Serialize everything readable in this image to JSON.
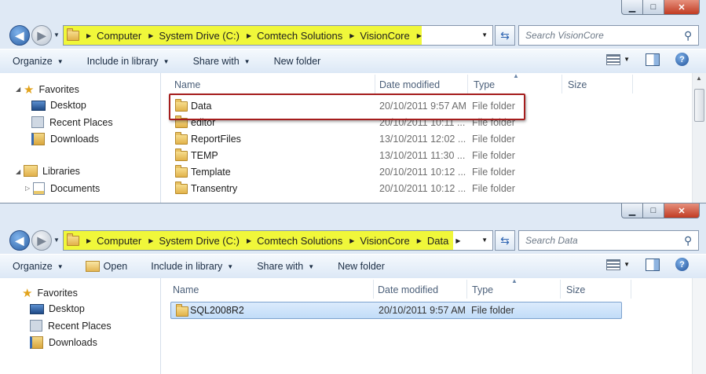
{
  "window1": {
    "breadcrumbs": [
      "Computer",
      "System Drive (C:)",
      "Comtech Solutions",
      "VisionCore"
    ],
    "search_placeholder": "Search VisionCore",
    "toolbar": {
      "organize": "Organize",
      "include": "Include in library",
      "share": "Share with",
      "new_folder": "New folder"
    },
    "nav": {
      "favorites": "Favorites",
      "desktop": "Desktop",
      "recent": "Recent Places",
      "downloads": "Downloads",
      "libraries": "Libraries",
      "documents": "Documents"
    },
    "columns": {
      "name": "Name",
      "date": "Date modified",
      "type": "Type",
      "size": "Size"
    },
    "files": [
      {
        "name": "Data",
        "date": "20/10/2011 9:57 AM",
        "type": "File folder"
      },
      {
        "name": "editor",
        "date": "20/10/2011 10:11 ...",
        "type": "File folder"
      },
      {
        "name": "ReportFiles",
        "date": "13/10/2011 12:02 ...",
        "type": "File folder"
      },
      {
        "name": "TEMP",
        "date": "13/10/2011 11:30 ...",
        "type": "File folder"
      },
      {
        "name": "Template",
        "date": "20/10/2011 10:12 ...",
        "type": "File folder"
      },
      {
        "name": "Transentry",
        "date": "20/10/2011 10:12 ...",
        "type": "File folder"
      }
    ]
  },
  "window2": {
    "breadcrumbs": [
      "Computer",
      "System Drive (C:)",
      "Comtech Solutions",
      "VisionCore",
      "Data"
    ],
    "search_placeholder": "Search Data",
    "toolbar": {
      "organize": "Organize",
      "open": "Open",
      "include": "Include in library",
      "share": "Share with",
      "new_folder": "New folder"
    },
    "nav": {
      "favorites": "Favorites",
      "desktop": "Desktop",
      "recent": "Recent Places",
      "downloads": "Downloads"
    },
    "columns": {
      "name": "Name",
      "date": "Date modified",
      "type": "Type",
      "size": "Size"
    },
    "files": [
      {
        "name": "SQL2008R2",
        "date": "20/10/2011 9:57 AM",
        "type": "File folder"
      }
    ]
  },
  "colors": {
    "address_highlight": "#f0f73a",
    "callout_border": "#a51d1d",
    "selection": "#c1dcf8"
  },
  "icons": {
    "back": "back-arrow-icon",
    "forward": "forward-arrow-icon",
    "refresh": "refresh-icon",
    "search": "magnifier-icon",
    "help": "help-icon"
  }
}
